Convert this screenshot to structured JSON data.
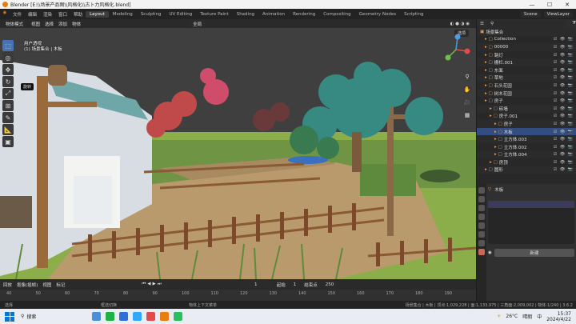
{
  "window": {
    "title": "Blender [E:\\\\场景产品图\\\\风格化\\\\古卜力风格化.blend]"
  },
  "menu": {
    "items": [
      "文件",
      "编辑",
      "渲染",
      "窗口",
      "帮助"
    ],
    "workspaces": [
      "Layout",
      "Modeling",
      "Sculpting",
      "UV Editing",
      "Texture Paint",
      "Shading",
      "Animation",
      "Rendering",
      "Compositing",
      "Geometry Nodes",
      "Scripting"
    ],
    "active_workspace": "Layout",
    "scene": "Scene",
    "view_layer": "ViewLayer"
  },
  "viewport_header": {
    "mode": "物体模式",
    "menus": [
      "视图",
      "选择",
      "添加",
      "物体"
    ],
    "orientation": "全局",
    "options": "选项"
  },
  "viewport": {
    "info_line1": "用户透视",
    "info_line2": "(1) 场景集合 | 木板",
    "tooltip": "旋转"
  },
  "outliner": {
    "rows": [
      {
        "name": "场景集合",
        "level": 0
      },
      {
        "name": "Collection",
        "level": 1
      },
      {
        "name": "00000",
        "level": 1
      },
      {
        "name": "路灯",
        "level": 1
      },
      {
        "name": "栅栏.001",
        "level": 1
      },
      {
        "name": "东面",
        "level": 1
      },
      {
        "name": "草地",
        "level": 1
      },
      {
        "name": "石头花园",
        "level": 1
      },
      {
        "name": "树木花园",
        "level": 1
      },
      {
        "name": "房子",
        "level": 1
      },
      {
        "name": "砖墙",
        "level": 2
      },
      {
        "name": "房子.001",
        "level": 2
      },
      {
        "name": "房子",
        "level": 3
      },
      {
        "name": "木板",
        "level": 3
      },
      {
        "name": "立方体.003",
        "level": 3
      },
      {
        "name": "立方体.002",
        "level": 3
      },
      {
        "name": "立方体.004",
        "level": 3
      },
      {
        "name": "房顶",
        "level": 2
      },
      {
        "name": "圆形",
        "level": 1
      }
    ],
    "selected": "木板"
  },
  "properties": {
    "object": "木板",
    "new_button": "新建"
  },
  "timeline": {
    "menus": [
      "回放",
      "抠像(插帧)",
      "视图",
      "标记"
    ],
    "current_frame": "1",
    "start_label": "起始",
    "start": "1",
    "end_label": "结束点",
    "end": "250",
    "ticks": [
      "40",
      "50",
      "60",
      "70",
      "80",
      "90",
      "100",
      "110",
      "120",
      "130",
      "140",
      "150",
      "160",
      "170",
      "180",
      "190"
    ]
  },
  "status": {
    "left": "选择",
    "mid1": "框选切换",
    "mid2": "物体上下文菜单",
    "right": "场景集合 | 木板 | 顶点:1,029,228 | 面:1,133,975 | 三角面:2,009,002 | 物体:1/240 | 3.6.2"
  },
  "taskbar": {
    "search": "搜索",
    "weather": "26°C",
    "weather_desc": "晴朗",
    "ime": "中",
    "time": "15:37",
    "date": "2024/4/22"
  },
  "colors": {
    "accent": "#4772b3",
    "select": "#334d80",
    "orange": "#e87d0d"
  }
}
